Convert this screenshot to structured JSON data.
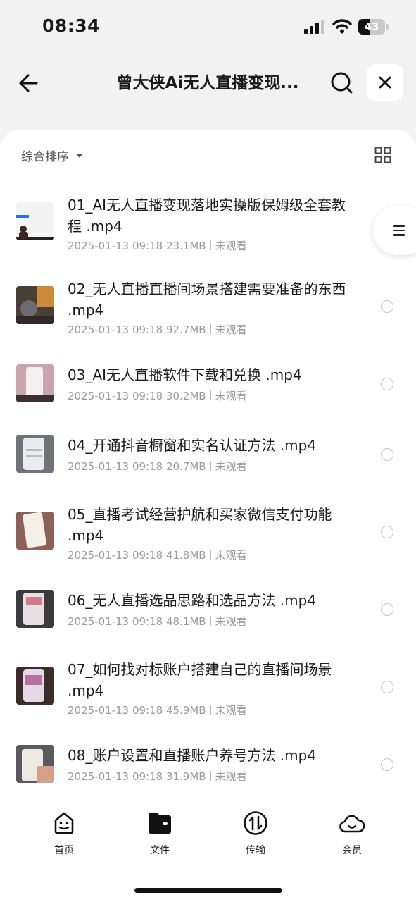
{
  "status_bar": {
    "time": "08:34",
    "battery": "43"
  },
  "header": {
    "title": "曾大侠Ai无人直播变现..."
  },
  "toolbar": {
    "sort_label": "综合排序"
  },
  "files": [
    {
      "name": "01_AI无人直播变现落地实操版保姆级全套教程 .mp4",
      "date": "2025-01-13 09:18",
      "size": "23.1MB",
      "status": "未观看"
    },
    {
      "name": "02_无人直播直播间场景搭建需要准备的东西 .mp4",
      "date": "2025-01-13 09:18",
      "size": "92.7MB",
      "status": "未观看"
    },
    {
      "name": "03_AI无人直播软件下载和兑换 .mp4",
      "date": "2025-01-13 09:18",
      "size": "30.2MB",
      "status": "未观看"
    },
    {
      "name": "04_开通抖音橱窗和实名认证方法 .mp4",
      "date": "2025-01-13 09:18",
      "size": "20.7MB",
      "status": "未观看"
    },
    {
      "name": "05_直播考试经营护航和买家微信支付功能 .mp4",
      "date": "2025-01-13 09:18",
      "size": "41.8MB",
      "status": "未观看"
    },
    {
      "name": "06_无人直播选品思路和选品方法 .mp4",
      "date": "2025-01-13 09:18",
      "size": "48.1MB",
      "status": "未观看"
    },
    {
      "name": "07_如何找对标账户搭建自己的直播间场景 .mp4",
      "date": "2025-01-13 09:18",
      "size": "45.9MB",
      "status": "未观看"
    },
    {
      "name": "08_账户设置和直播账户养号方法 .mp4",
      "date": "2025-01-13 09:18",
      "size": "31.9MB",
      "status": "未观看"
    }
  ],
  "nav": [
    {
      "label": "首页",
      "icon": "smile-face-icon"
    },
    {
      "label": "文件",
      "icon": "folder-icon"
    },
    {
      "label": "传输",
      "icon": "transfer-icon"
    },
    {
      "label": "会员",
      "icon": "cloud-icon"
    }
  ]
}
